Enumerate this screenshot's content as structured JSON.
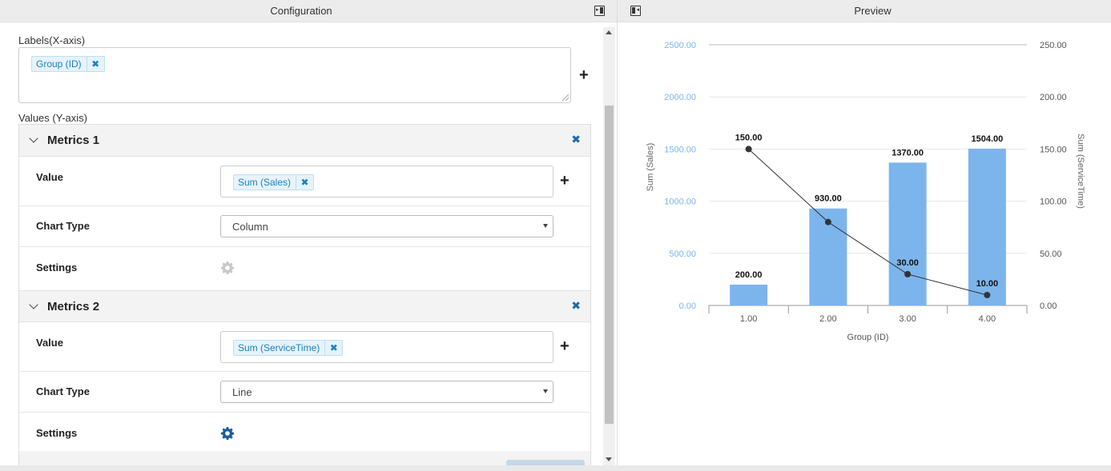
{
  "left_panel": {
    "title": "Configuration",
    "labels_section": {
      "label": "Labels(X-axis)",
      "chips": [
        {
          "text": "Group (ID)",
          "remove": "✖"
        }
      ],
      "add_label": "+"
    },
    "values_section": {
      "label": "Values (Y-axis)"
    },
    "metrics": [
      {
        "title": "Metrics 1",
        "remove": "✖",
        "value_label": "Value",
        "value_chip": "Sum (Sales)",
        "value_chip_remove": "✖",
        "add_value": "+",
        "chart_type_label": "Chart Type",
        "chart_type": "Column",
        "settings_label": "Settings",
        "settings_icon": "gear-icon",
        "settings_color": "#c8c8c8"
      },
      {
        "title": "Metrics 2",
        "remove": "✖",
        "value_label": "Value",
        "value_chip": "Sum (ServiceTime)",
        "value_chip_remove": "✖",
        "add_value": "+",
        "chart_type_label": "Chart Type",
        "chart_type": "Line",
        "settings_label": "Settings",
        "settings_icon": "gear-icon",
        "settings_color": "#1a5f9c"
      }
    ]
  },
  "right_panel": {
    "title": "Preview"
  },
  "colors": {
    "bar": "#7cb5ec",
    "line": "#333333",
    "left_axis_text": "#7cb5ec",
    "right_axis_text": "#555555",
    "accent": "#1b83bd"
  },
  "chart_data": {
    "type": "bar",
    "categories": [
      "1.00",
      "2.00",
      "3.00",
      "4.00"
    ],
    "xlabel": "Group (ID)",
    "series": [
      {
        "name": "Sum (Sales)",
        "type": "bar",
        "axis": "left",
        "values": [
          200,
          930,
          1370,
          1504
        ],
        "labels": [
          "200.00",
          "930.00",
          "1370.00",
          "1504.00"
        ]
      },
      {
        "name": "Sum (ServiceTime)",
        "type": "line",
        "axis": "right",
        "values": [
          150,
          80,
          30,
          10
        ],
        "labels": [
          "150.00",
          "",
          "30.00",
          "10.00"
        ]
      }
    ],
    "extra_labels": [
      "930.00"
    ],
    "y_left": {
      "label": "Sum (Sales)",
      "min": 0,
      "max": 2500,
      "ticks": [
        "0.00",
        "500.00",
        "1000.00",
        "1500.00",
        "2000.00",
        "2500.00"
      ]
    },
    "y_right": {
      "label": "Sum (ServiceTime)",
      "min": 0,
      "max": 250,
      "ticks": [
        "0.00",
        "50.00",
        "100.00",
        "150.00",
        "200.00",
        "250.00"
      ]
    },
    "grid": true,
    "legend": "none"
  }
}
